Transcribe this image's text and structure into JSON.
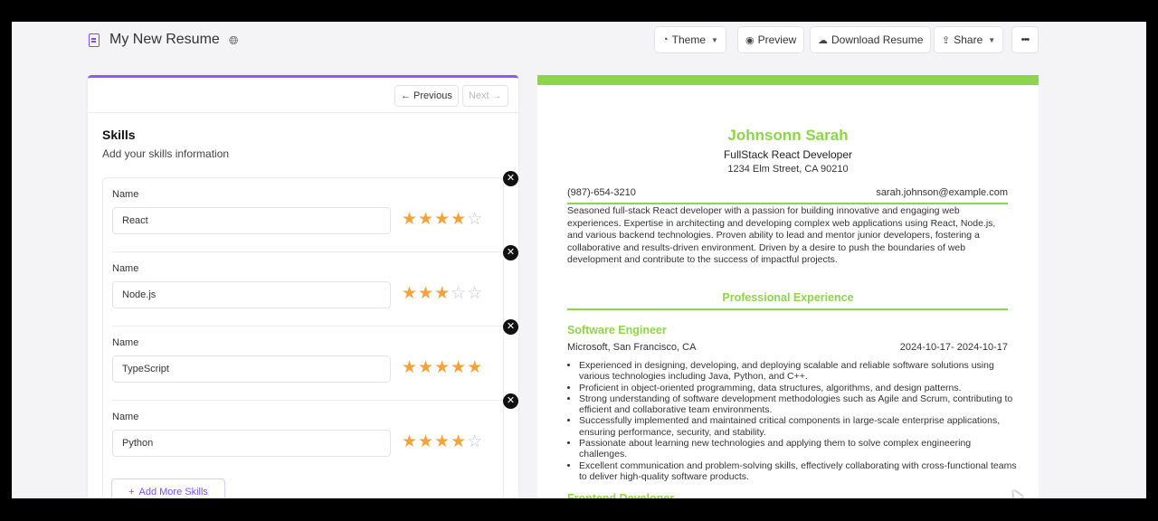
{
  "header": {
    "title": "My New Resume",
    "buttons": {
      "theme": "Theme",
      "preview": "Preview",
      "download": "Download Resume",
      "share": "Share",
      "more": "•••"
    }
  },
  "editor": {
    "previous_label": "← Previous",
    "next_label": "Next →",
    "section_title": "Skills",
    "section_subtitle": "Add your skills information",
    "field_label": "Name",
    "skills": [
      {
        "name": "React",
        "rating": 4
      },
      {
        "name": "Node.js",
        "rating": 3
      },
      {
        "name": "TypeScript",
        "rating": 5
      },
      {
        "name": "Python",
        "rating": 4
      }
    ],
    "max_rating": 5,
    "add_label": "Add More Skills"
  },
  "resume": {
    "name": "Johnsonn Sarah",
    "title": "FullStack React Developer",
    "address": "1234 Elm Street, CA 90210",
    "phone": "(987)-654-3210",
    "email": "sarah.johnson@example.com",
    "summary": "Seasoned full-stack React developer with a passion for building innovative and engaging web experiences. Expertise in architecting and developing complex web applications using React, Node.js, and various backend technologies. Proven ability to lead and mentor junior developers, fostering a collaborative and results-driven environment. Driven by a desire to push the boundaries of web development and contribute to the success of impactful projects.",
    "experience_heading": "Professional Experience",
    "jobs": [
      {
        "role": "Software Engineer",
        "company": "Microsoft, San Francisco, CA",
        "dates": "2024-10-17- 2024-10-17",
        "bullets": [
          "Experienced in designing, developing, and deploying scalable and reliable software solutions using various technologies including Java, Python, and C++.",
          "Proficient in object-oriented programming, data structures, algorithms, and design patterns.",
          "Strong understanding of software development methodologies such as Agile and Scrum, contributing to efficient and collaborative team environments.",
          "Successfully implemented and maintained critical components in large-scale enterprise applications, ensuring performance, security, and stability.",
          "Passionate about learning new technologies and applying them to solve complex engineering challenges.",
          "Excellent communication and problem-solving skills, effectively collaborating with cross-functional teams to deliver high-quality software products."
        ]
      },
      {
        "role": "Frontend Developer"
      }
    ]
  },
  "colors": {
    "accent": "#8e5bf0",
    "resume_accent": "#8ed44a",
    "star": "#f4a23a"
  }
}
